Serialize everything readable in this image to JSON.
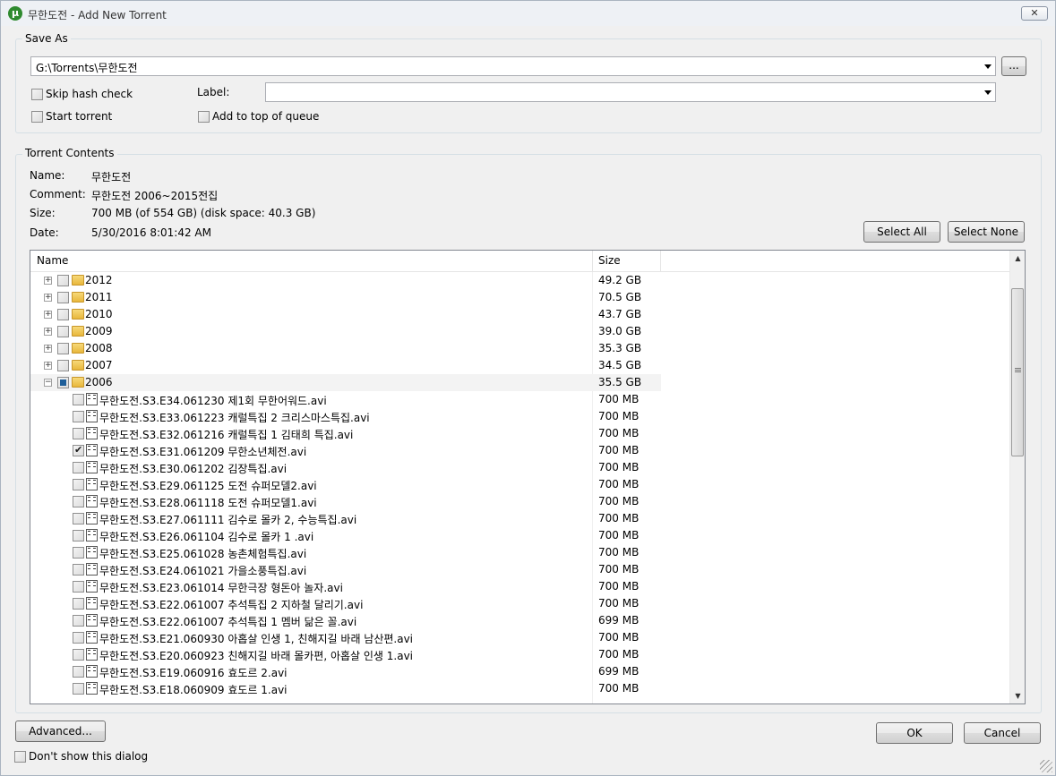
{
  "window": {
    "title": "무한도전 - Add New Torrent",
    "close_label": "✕"
  },
  "save_as": {
    "legend": "Save As",
    "path": "G:\\Torrents\\무한도전",
    "browse_label": "...",
    "skip_hash_label": "Skip hash check",
    "start_torrent_label": "Start torrent",
    "label_caption": "Label:",
    "label_value": "",
    "add_top_label": "Add to top of queue"
  },
  "contents": {
    "legend": "Torrent Contents",
    "name_caption": "Name:",
    "name_value": "무한도전",
    "comment_caption": "Comment:",
    "comment_value": "무한도전 2006~2015전집",
    "size_caption": "Size:",
    "size_value": "700 MB (of 554 GB) (disk space: 40.3 GB)",
    "date_caption": "Date:",
    "date_value": "5/30/2016 8:01:42 AM",
    "select_all_label": "Select All",
    "select_none_label": "Select None"
  },
  "tree": {
    "columns": {
      "name": "Name",
      "size": "Size"
    },
    "folders": [
      {
        "name": "2012",
        "size": "49.2 GB"
      },
      {
        "name": "2011",
        "size": "70.5 GB"
      },
      {
        "name": "2010",
        "size": "43.7 GB"
      },
      {
        "name": "2009",
        "size": "39.0 GB"
      },
      {
        "name": "2008",
        "size": "35.3 GB"
      },
      {
        "name": "2007",
        "size": "34.5 GB"
      },
      {
        "name": "2006",
        "size": "35.5 GB"
      }
    ],
    "files": [
      {
        "name": "무한도전.S3.E34.061230 제1회 무한어워드.avi",
        "size": "700 MB",
        "checked": false
      },
      {
        "name": "무한도전.S3.E33.061223 캐럴특집 2 크리스마스특집.avi",
        "size": "700 MB",
        "checked": false
      },
      {
        "name": "무한도전.S3.E32.061216 캐럴특집 1 김태희 특집.avi",
        "size": "700 MB",
        "checked": false
      },
      {
        "name": "무한도전.S3.E31.061209 무한소년체전.avi",
        "size": "700 MB",
        "checked": true
      },
      {
        "name": "무한도전.S3.E30.061202 김장특집.avi",
        "size": "700 MB",
        "checked": false
      },
      {
        "name": "무한도전.S3.E29.061125 도전 슈퍼모델2.avi",
        "size": "700 MB",
        "checked": false
      },
      {
        "name": "무한도전.S3.E28.061118 도전 슈퍼모델1.avi",
        "size": "700 MB",
        "checked": false
      },
      {
        "name": "무한도전.S3.E27.061111 김수로 몰카 2, 수능특집.avi",
        "size": "700 MB",
        "checked": false
      },
      {
        "name": "무한도전.S3.E26.061104 김수로 몰카 1 .avi",
        "size": "700 MB",
        "checked": false
      },
      {
        "name": "무한도전.S3.E25.061028 농촌체험특집.avi",
        "size": "700 MB",
        "checked": false
      },
      {
        "name": "무한도전.S3.E24.061021 가을소풍특집.avi",
        "size": "700 MB",
        "checked": false
      },
      {
        "name": "무한도전.S3.E23.061014 무한극장 형돈아 놀자.avi",
        "size": "700 MB",
        "checked": false
      },
      {
        "name": "무한도전.S3.E22.061007 추석특집 2 지하철 달리기.avi",
        "size": "700 MB",
        "checked": false
      },
      {
        "name": "무한도전.S3.E22.061007 추석특집 1 멤버 닮은 꼴.avi",
        "size": "699 MB",
        "checked": false
      },
      {
        "name": "무한도전.S3.E21.060930 아홉살 인생 1, 친해지길 바래 남산편.avi",
        "size": "700 MB",
        "checked": false
      },
      {
        "name": "무한도전.S3.E20.060923 친해지길 바래 몰카편, 아홉살 인생 1.avi",
        "size": "700 MB",
        "checked": false
      },
      {
        "name": "무한도전.S3.E19.060916 효도르 2.avi",
        "size": "699 MB",
        "checked": false
      },
      {
        "name": "무한도전.S3.E18.060909 효도르 1.avi",
        "size": "700 MB",
        "checked": false
      }
    ]
  },
  "footer": {
    "advanced_label": "Advanced...",
    "ok_label": "OK",
    "cancel_label": "Cancel",
    "dont_show_label": "Don't show this dialog"
  }
}
